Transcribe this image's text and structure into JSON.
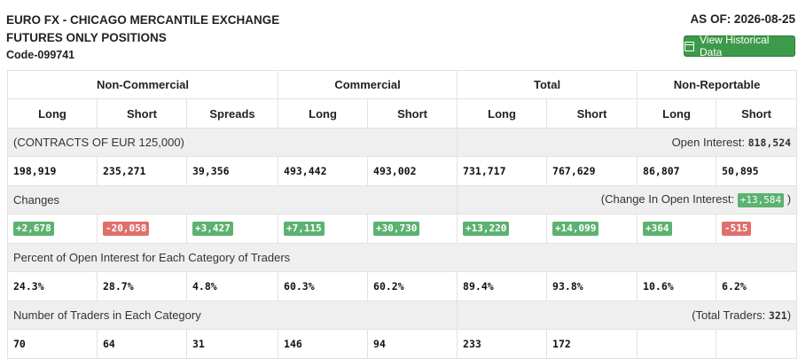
{
  "header": {
    "title_line1": "EURO FX - CHICAGO MERCANTILE EXCHANGE",
    "title_line2": "FUTURES ONLY POSITIONS",
    "code": "Code-099741",
    "as_of": "AS OF: 2026-08-25",
    "history_button": "View Historical Data"
  },
  "groups": [
    "Non-Commercial",
    "Commercial",
    "Total",
    "Non-Reportable"
  ],
  "subheaders": [
    "Long",
    "Short",
    "Spreads",
    "Long",
    "Short",
    "Long",
    "Short",
    "Long",
    "Short"
  ],
  "contracts": {
    "label": "(CONTRACTS OF EUR 125,000)",
    "oi_label": "Open Interest:",
    "oi_value": "818,524",
    "values": [
      "198,919",
      "235,271",
      "39,356",
      "493,442",
      "493,002",
      "731,717",
      "767,629",
      "86,807",
      "50,895"
    ]
  },
  "changes": {
    "label": "Changes",
    "coi_prefix": "(Change In Open Interest:",
    "coi_value": "+13,584",
    "coi_suffix": ")",
    "values": [
      "+2,678",
      "-20,058",
      "+3,427",
      "+7,115",
      "+30,730",
      "+13,220",
      "+14,099",
      "+364",
      "-515"
    ]
  },
  "percent": {
    "label": "Percent of Open Interest for Each Category of Traders",
    "values": [
      "24.3%",
      "28.7%",
      "4.8%",
      "60.3%",
      "60.2%",
      "89.4%",
      "93.8%",
      "10.6%",
      "6.2%"
    ]
  },
  "traders": {
    "label": "Number of Traders in Each Category",
    "total_prefix": "(Total Traders:",
    "total_value": "321",
    "total_suffix": ")",
    "values": [
      "70",
      "64",
      "31",
      "146",
      "94",
      "233",
      "172",
      "",
      ""
    ]
  },
  "colors": {
    "positive": "#5cb270",
    "negative": "#e0706c",
    "button": "#3d9a4a"
  }
}
